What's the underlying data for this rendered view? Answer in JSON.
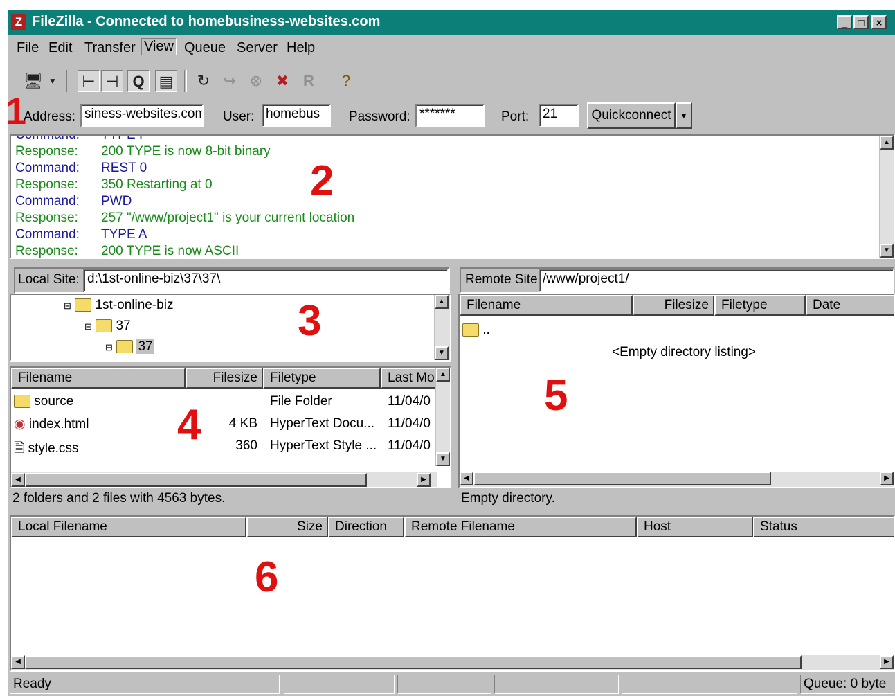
{
  "window": {
    "title": "FileZilla - Connected to homebusiness-websites.com",
    "app_icon": "Z"
  },
  "window_buttons": {
    "minimize": "_",
    "maximize": "□",
    "close": "×"
  },
  "menu": [
    "File",
    "Edit",
    "Transfer",
    "View",
    "Queue",
    "Server",
    "Help"
  ],
  "quickconnect": {
    "address_label": "Address:",
    "address_value": "siness-websites.com",
    "user_label": "User:",
    "user_value": "homebus",
    "password_label": "Password:",
    "password_value": "*******",
    "port_label": "Port:",
    "port_value": "21",
    "button_label": "Quickconnect"
  },
  "log": [
    {
      "type": "Command:",
      "text": "TYPE I",
      "kind": "cmd"
    },
    {
      "type": "Response:",
      "text": "200 TYPE is now 8-bit binary",
      "kind": "resp"
    },
    {
      "type": "Command:",
      "text": "REST 0",
      "kind": "cmd"
    },
    {
      "type": "Response:",
      "text": "350 Restarting at 0",
      "kind": "resp"
    },
    {
      "type": "Command:",
      "text": "PWD",
      "kind": "cmd"
    },
    {
      "type": "Response:",
      "text": "257 \"/www/project1\" is your current location",
      "kind": "resp"
    },
    {
      "type": "Command:",
      "text": "TYPE A",
      "kind": "cmd"
    },
    {
      "type": "Response:",
      "text": "200 TYPE is now ASCII",
      "kind": "resp"
    }
  ],
  "local": {
    "site_label": "Local Site:",
    "site_path": "d:\\1st-online-biz\\37\\37\\",
    "tree": [
      {
        "label": "1st-online-biz",
        "level": 0
      },
      {
        "label": "37",
        "level": 1
      },
      {
        "label": "37",
        "level": 2
      }
    ],
    "columns": [
      "Filename",
      "Filesize",
      "Filetype",
      "Last Mo"
    ],
    "files": [
      {
        "name": "source",
        "size": "",
        "type": "File Folder",
        "date": "11/04/0",
        "icon": "folder-icon"
      },
      {
        "name": "index.html",
        "size": "4 KB",
        "type": "HyperText Docu...",
        "date": "11/04/0",
        "icon": "html-file-icon"
      },
      {
        "name": "style.css",
        "size": "360",
        "type": "HyperText Style ...",
        "date": "11/04/0",
        "icon": "css-file-icon"
      }
    ],
    "status": "2 folders and 2 files with 4563 bytes."
  },
  "remote": {
    "site_label": "Remote Site:",
    "site_path": "/www/project1/",
    "columns": [
      "Filename",
      "Filesize",
      "Filetype",
      "Date"
    ],
    "parent": "..",
    "empty_text": "<Empty directory listing>",
    "status": "Empty directory."
  },
  "queue": {
    "columns": [
      "Local Filename",
      "Size",
      "Direction",
      "Remote Filename",
      "Host",
      "Status"
    ]
  },
  "statusbar": {
    "ready": "Ready",
    "queue": "Queue: 0 byte"
  },
  "annotations": [
    "1",
    "2",
    "3",
    "4",
    "5",
    "6"
  ]
}
